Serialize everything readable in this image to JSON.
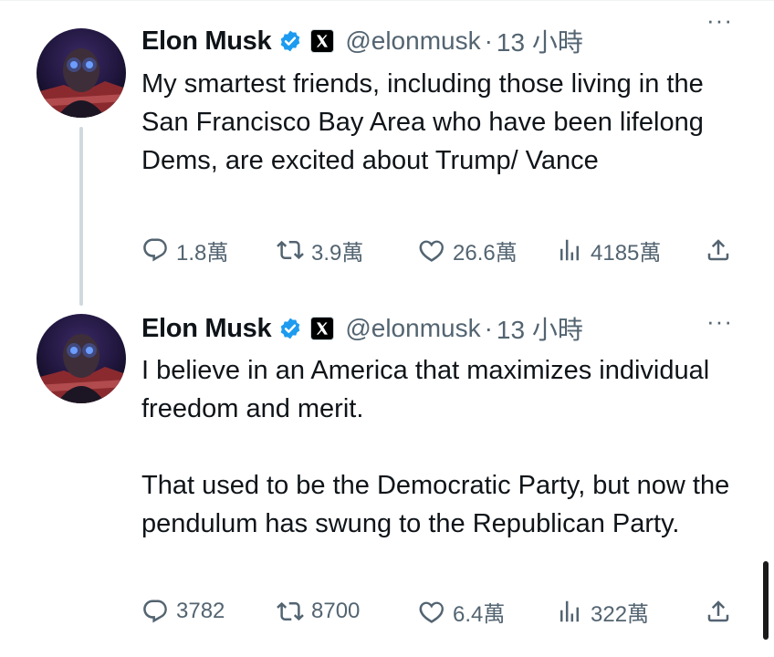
{
  "tweets": [
    {
      "author": {
        "name": "Elon Musk",
        "handle": "@elonmusk",
        "time": "13 小時",
        "verified_color": "#1d9bf0"
      },
      "body": [
        "My smartest friends, including those living in the San Francisco Bay Area who have been lifelong Dems, are excited about Trump/ Vance"
      ],
      "stats": {
        "replies": "1.8萬",
        "reposts": "3.9萬",
        "likes": "26.6萬",
        "views": "4185萬"
      }
    },
    {
      "author": {
        "name": "Elon Musk",
        "handle": "@elonmusk",
        "time": "13 小時",
        "verified_color": "#1d9bf0"
      },
      "body": [
        "I believe in an America that maximizes individual freedom and merit.",
        "That used to be the Democratic Party, but now the pendulum has swung to the Republican Party."
      ],
      "stats": {
        "replies": "3782",
        "reposts": "8700",
        "likes": "6.4萬",
        "views": "322萬"
      }
    }
  ],
  "ui": {
    "separator_dot": "·",
    "more_glyph": "···"
  },
  "icons": {
    "reply": "reply-icon",
    "repost": "repost-icon",
    "like": "like-icon",
    "views": "views-icon",
    "share": "share-icon",
    "verified": "verified-badge-icon",
    "affiliate": "x-logo-icon"
  }
}
